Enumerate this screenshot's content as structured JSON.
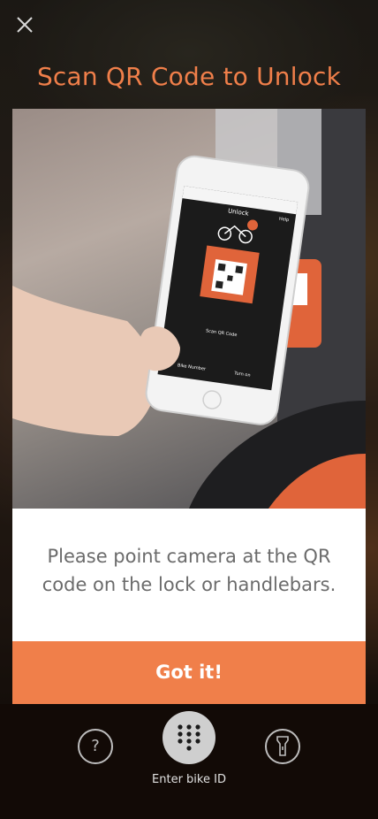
{
  "colors": {
    "accent": "#f07f4a",
    "card_background": "#ffffff",
    "instruction_text": "#6b6b6b",
    "bottom_bar": "#120a06"
  },
  "header": {
    "close_icon": "close-icon",
    "title": "Scan QR Code to Unlock"
  },
  "card": {
    "image_alt": "hand-holding-phone-scanning-qr-code",
    "phone_screen": {
      "title": "Unlock",
      "help": "Help",
      "scan_hint": "Scan QR Code",
      "bike_number": "Bike Number",
      "torch": "Turn on"
    },
    "instruction": "Please point camera at the QR code on the lock or handlebars.",
    "confirm_button": "Got it!"
  },
  "bottom_bar": {
    "help_button": {
      "icon": "question-icon",
      "label": "?"
    },
    "keypad_button": {
      "icon": "keypad-icon"
    },
    "keypad_label": "Enter bike ID",
    "torch_button": {
      "icon": "flashlight-icon"
    }
  }
}
